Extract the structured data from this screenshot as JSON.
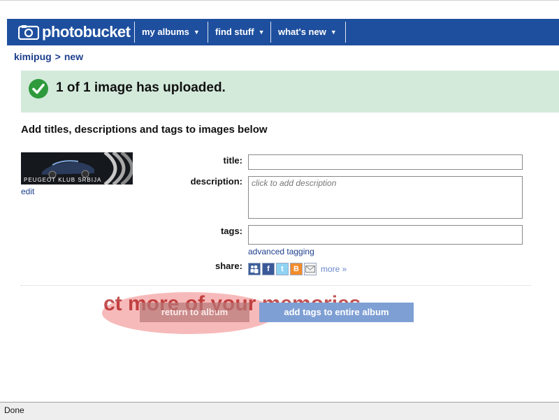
{
  "nav": {
    "logo_text": "photobucket",
    "items": [
      {
        "label": "my albums"
      },
      {
        "label": "find stuff"
      },
      {
        "label": "what's new"
      }
    ]
  },
  "breadcrumb": {
    "user": "kimipug",
    "separator": ">",
    "current": "new"
  },
  "banner": {
    "message": "1 of 1 image has uploaded."
  },
  "form": {
    "heading": "Add titles, descriptions and tags to images below",
    "thumbnail_caption": "PEUGEOT KLUB SRBIJA",
    "edit_label": "edit",
    "title_label": "title:",
    "title_value": "",
    "description_label": "description:",
    "description_placeholder": "click to add description",
    "tags_label": "tags:",
    "tags_value": "",
    "advanced_tagging_label": "advanced tagging",
    "share_label": "share:",
    "share_more_label": "more »",
    "share_icons": [
      "myspace-icon",
      "facebook-icon",
      "twitter-icon",
      "blogger-icon",
      "email-icon"
    ]
  },
  "overlay": {
    "text": "ct more of your memories"
  },
  "buttons": {
    "return_label": "return to album",
    "add_tags_label": "add tags to entire album"
  },
  "status": {
    "text": "Done"
  },
  "colors": {
    "nav_bg": "#1e4f9e",
    "banner_bg": "#d3eadb",
    "check_green": "#2e9a3c",
    "link": "#1d3f8c"
  }
}
